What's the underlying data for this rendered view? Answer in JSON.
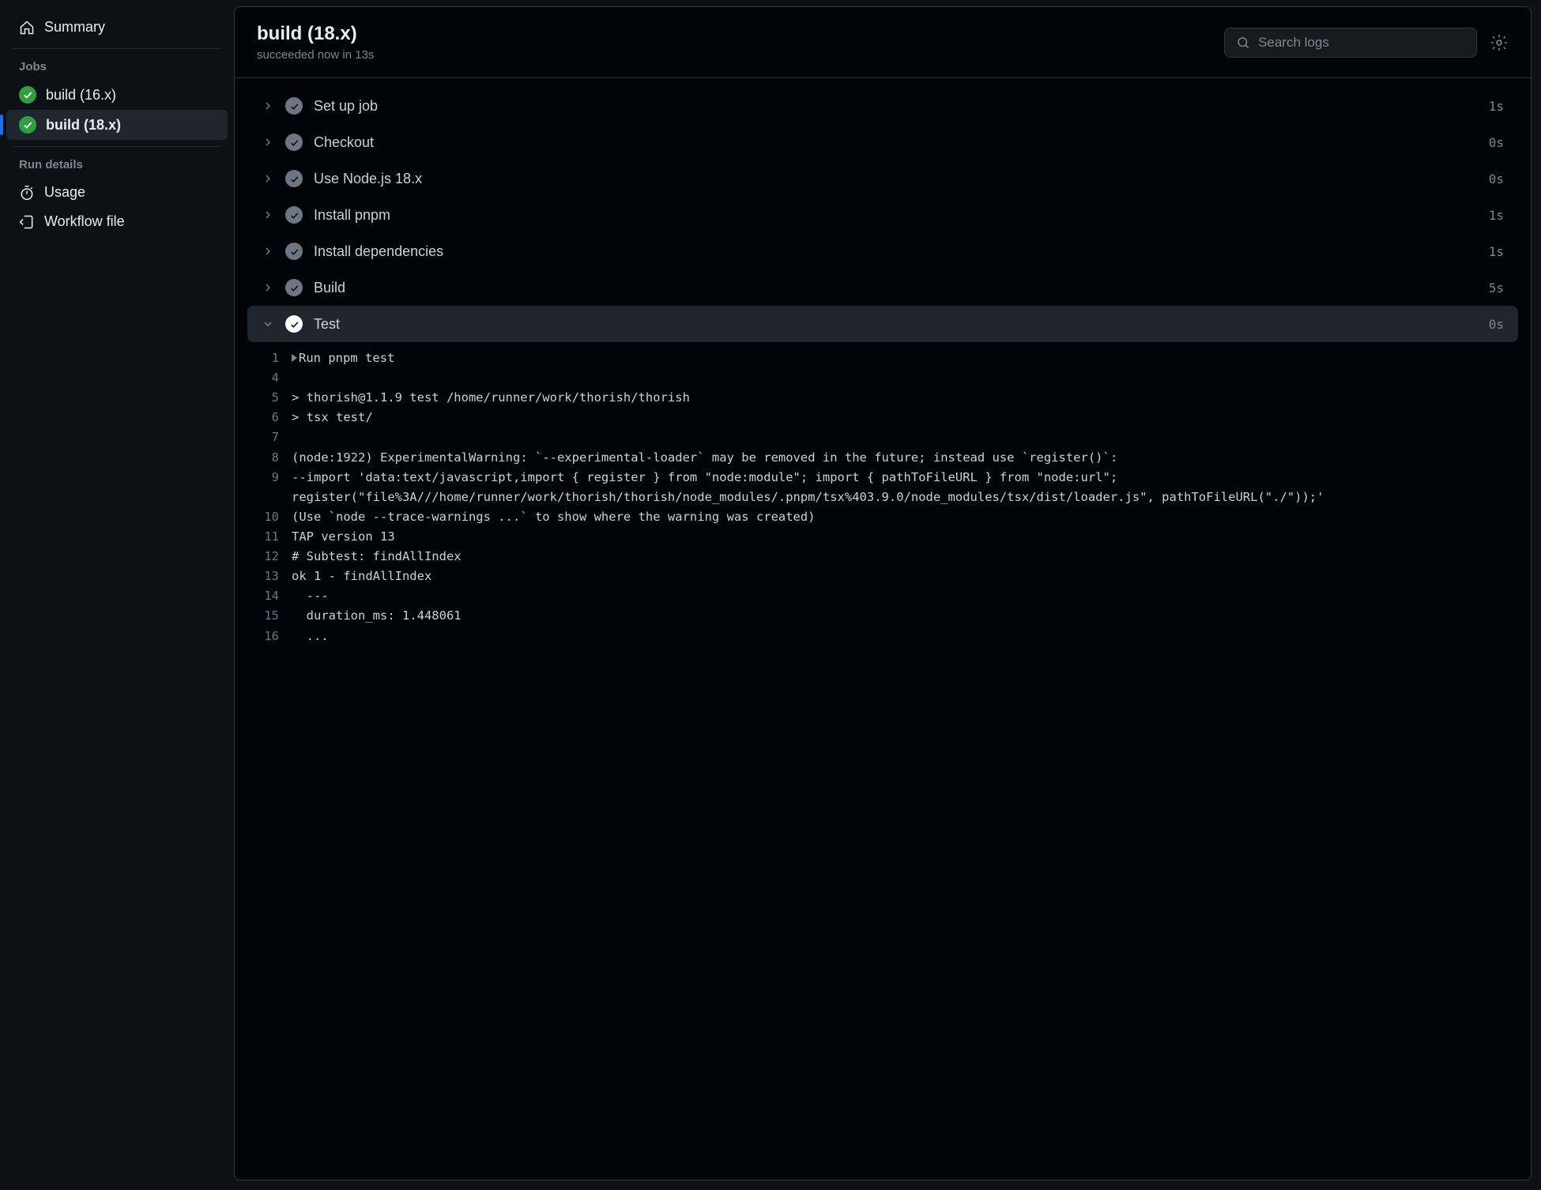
{
  "sidebar": {
    "summary_label": "Summary",
    "jobs_heading": "Jobs",
    "jobs": [
      {
        "label": "build (16.x)",
        "selected": false
      },
      {
        "label": "build (18.x)",
        "selected": true
      }
    ],
    "run_details_heading": "Run details",
    "usage_label": "Usage",
    "workflow_file_label": "Workflow file"
  },
  "header": {
    "title": "build (18.x)",
    "subtitle": "succeeded now in 13s",
    "search_placeholder": "Search logs"
  },
  "steps": [
    {
      "name": "Set up job",
      "time": "1s",
      "expanded": false
    },
    {
      "name": "Checkout",
      "time": "0s",
      "expanded": false
    },
    {
      "name": "Use Node.js 18.x",
      "time": "0s",
      "expanded": false
    },
    {
      "name": "Install pnpm",
      "time": "1s",
      "expanded": false
    },
    {
      "name": "Install dependencies",
      "time": "1s",
      "expanded": false
    },
    {
      "name": "Build",
      "time": "5s",
      "expanded": false
    },
    {
      "name": "Test",
      "time": "0s",
      "expanded": true
    }
  ],
  "log": [
    {
      "n": "1",
      "t": "Run pnpm test",
      "fold": true
    },
    {
      "n": "4",
      "t": ""
    },
    {
      "n": "5",
      "t": "> thorish@1.1.9 test /home/runner/work/thorish/thorish"
    },
    {
      "n": "6",
      "t": "> tsx test/"
    },
    {
      "n": "7",
      "t": ""
    },
    {
      "n": "8",
      "t": "(node:1922) ExperimentalWarning: `--experimental-loader` may be removed in the future; instead use `register()`:"
    },
    {
      "n": "9",
      "t": "--import 'data:text/javascript,import { register } from \"node:module\"; import { pathToFileURL } from \"node:url\"; register(\"file%3A///home/runner/work/thorish/thorish/node_modules/.pnpm/tsx%403.9.0/node_modules/tsx/dist/loader.js\", pathToFileURL(\"./\"));'"
    },
    {
      "n": "10",
      "t": "(Use `node --trace-warnings ...` to show where the warning was created)"
    },
    {
      "n": "11",
      "t": "TAP version 13"
    },
    {
      "n": "12",
      "t": "# Subtest: findAllIndex"
    },
    {
      "n": "13",
      "t": "ok 1 - findAllIndex"
    },
    {
      "n": "14",
      "t": "  ---"
    },
    {
      "n": "15",
      "t": "  duration_ms: 1.448061"
    },
    {
      "n": "16",
      "t": "  ..."
    }
  ]
}
